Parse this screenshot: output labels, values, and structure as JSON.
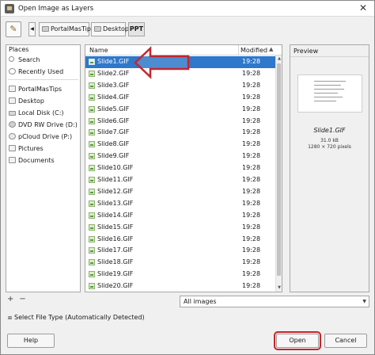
{
  "window": {
    "title": "Open Image as Layers"
  },
  "toolbar": {
    "edit_icon": "pencil-icon",
    "breadcrumb": [
      "PortalMasTips",
      "Desktop",
      "PPT"
    ]
  },
  "places": {
    "header": "Places",
    "items": [
      {
        "label": "Search",
        "icon": "search-icon"
      },
      {
        "label": "Recently Used",
        "icon": "clock-icon"
      },
      {
        "label": "PortalMasTips",
        "icon": "folder-icon"
      },
      {
        "label": "Desktop",
        "icon": "folder-icon"
      },
      {
        "label": "Local Disk (C:)",
        "icon": "disk-icon"
      },
      {
        "label": "DVD RW Drive (D:)",
        "icon": "dvd-icon"
      },
      {
        "label": "pCloud Drive (P:)",
        "icon": "cloud-icon"
      },
      {
        "label": "Pictures",
        "icon": "folder-icon"
      },
      {
        "label": "Documents",
        "icon": "folder-icon"
      }
    ],
    "add_label": "+",
    "remove_label": "−"
  },
  "files": {
    "col_name": "Name",
    "col_modified": "Modified",
    "sort_indicator": "▲",
    "selected": "Slide1.GIF",
    "rows": [
      {
        "name": "Slide1.GIF",
        "modified": "19:28"
      },
      {
        "name": "Slide2.GIF",
        "modified": "19:28"
      },
      {
        "name": "Slide3.GIF",
        "modified": "19:28"
      },
      {
        "name": "Slide4.GIF",
        "modified": "19:28"
      },
      {
        "name": "Slide5.GIF",
        "modified": "19:28"
      },
      {
        "name": "Slide6.GIF",
        "modified": "19:28"
      },
      {
        "name": "Slide7.GIF",
        "modified": "19:28"
      },
      {
        "name": "Slide8.GIF",
        "modified": "19:28"
      },
      {
        "name": "Slide9.GIF",
        "modified": "19:28"
      },
      {
        "name": "Slide10.GIF",
        "modified": "19:28"
      },
      {
        "name": "Slide11.GIF",
        "modified": "19:28"
      },
      {
        "name": "Slide12.GIF",
        "modified": "19:28"
      },
      {
        "name": "Slide13.GIF",
        "modified": "19:28"
      },
      {
        "name": "Slide14.GIF",
        "modified": "19:28"
      },
      {
        "name": "Slide15.GIF",
        "modified": "19:28"
      },
      {
        "name": "Slide16.GIF",
        "modified": "19:28"
      },
      {
        "name": "Slide17.GIF",
        "modified": "19:28"
      },
      {
        "name": "Slide18.GIF",
        "modified": "19:28"
      },
      {
        "name": "Slide19.GIF",
        "modified": "19:28"
      },
      {
        "name": "Slide20.GIF",
        "modified": "19:28"
      }
    ]
  },
  "preview": {
    "header": "Preview",
    "filename": "Slide1.GIF",
    "size": "31.0 kB",
    "dimensions": "1280 × 720 pixels"
  },
  "filter": {
    "value": "All images"
  },
  "file_type": {
    "label": "Select File Type (Automatically Detected)"
  },
  "buttons": {
    "help": "Help",
    "open": "Open",
    "cancel": "Cancel"
  },
  "colors": {
    "selection": "#2f78cb",
    "annotation_red": "#c1272d"
  }
}
